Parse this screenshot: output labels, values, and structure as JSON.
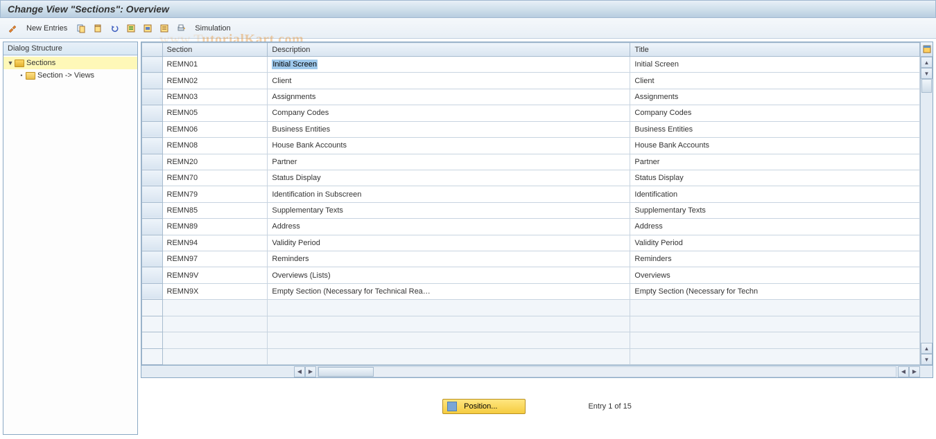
{
  "header": {
    "title": "Change View \"Sections\": Overview"
  },
  "toolbar": {
    "new_entries": "New Entries",
    "simulation": "Simulation"
  },
  "tree": {
    "header": "Dialog Structure",
    "root": "Sections",
    "child": "Section -> Views"
  },
  "columns": {
    "section": "Section",
    "description": "Description",
    "title": "Title"
  },
  "rows": [
    {
      "section": "REMN01",
      "description": "Initial Screen",
      "title": "Initial Screen",
      "selected": true
    },
    {
      "section": "REMN02",
      "description": "Client",
      "title": "Client"
    },
    {
      "section": "REMN03",
      "description": "Assignments",
      "title": "Assignments"
    },
    {
      "section": "REMN05",
      "description": "Company Codes",
      "title": "Company Codes"
    },
    {
      "section": "REMN06",
      "description": "Business Entities",
      "title": "Business Entities"
    },
    {
      "section": "REMN08",
      "description": "House Bank Accounts",
      "title": "House Bank Accounts"
    },
    {
      "section": "REMN20",
      "description": "Partner",
      "title": "Partner"
    },
    {
      "section": "REMN70",
      "description": "Status Display",
      "title": "Status Display"
    },
    {
      "section": "REMN79",
      "description": "Identification in Subscreen",
      "title": "Identification"
    },
    {
      "section": "REMN85",
      "description": "Supplementary Texts",
      "title": "Supplementary Texts"
    },
    {
      "section": "REMN89",
      "description": "Address",
      "title": "Address"
    },
    {
      "section": "REMN94",
      "description": "Validity Period",
      "title": "Validity Period"
    },
    {
      "section": "REMN97",
      "description": "Reminders",
      "title": "Reminders"
    },
    {
      "section": "REMN9V",
      "description": "Overviews (Lists)",
      "title": "Overviews"
    },
    {
      "section": "REMN9X",
      "description": "Empty Section (Necessary for Technical Rea…",
      "title": "Empty Section (Necessary for Techn"
    }
  ],
  "empty_rows": 4,
  "footer": {
    "position_label": "Position...",
    "entry_text": "Entry 1 of 15"
  },
  "watermark": {
    "faint": "www.T",
    "main": "utorialKart.com"
  }
}
